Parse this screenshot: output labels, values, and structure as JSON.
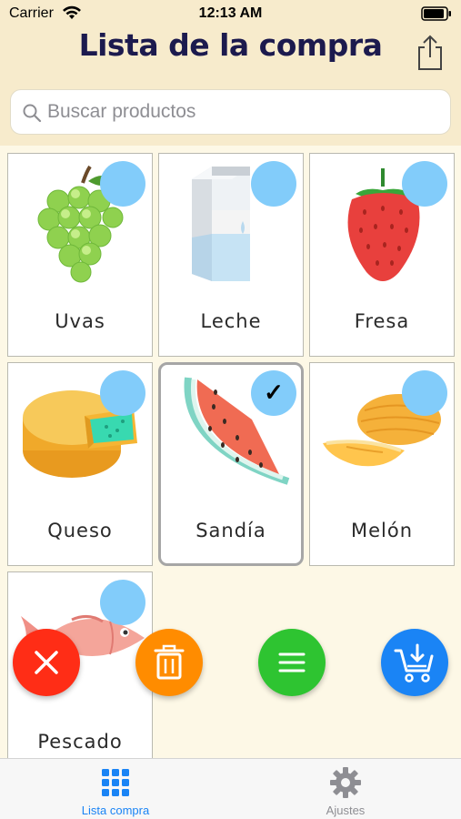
{
  "status_bar": {
    "carrier": "Carrier",
    "time": "12:13 AM"
  },
  "header": {
    "title": "Lista de la compra"
  },
  "search": {
    "placeholder": "Buscar productos"
  },
  "products": [
    {
      "name": "Uvas",
      "selected": false,
      "icon": "grapes-icon"
    },
    {
      "name": "Leche",
      "selected": false,
      "icon": "milk-carton-icon"
    },
    {
      "name": "Fresa",
      "selected": false,
      "icon": "strawberry-icon"
    },
    {
      "name": "Queso",
      "selected": false,
      "icon": "cheese-icon"
    },
    {
      "name": "Sandía",
      "selected": true,
      "icon": "watermelon-icon"
    },
    {
      "name": "Melón",
      "selected": false,
      "icon": "melon-icon"
    },
    {
      "name": "Pescado",
      "selected": false,
      "icon": "fish-icon"
    }
  ],
  "actions": {
    "clear": {
      "icon": "close-icon",
      "color": "#ff2d16"
    },
    "delete": {
      "icon": "trash-icon",
      "color": "#ff8c00"
    },
    "list": {
      "icon": "list-icon",
      "color": "#2ec431"
    },
    "cart": {
      "icon": "cart-download-icon",
      "color": "#1a84f5"
    }
  },
  "colors": {
    "header_bg": "#f7ebcc",
    "page_bg": "#fdf8e6",
    "check_circle": "#82ccfa",
    "tab_active": "#1a84f5",
    "tab_inactive": "#8e8e93"
  },
  "tabs": [
    {
      "label": "Lista compra",
      "icon": "grid-icon",
      "active": true
    },
    {
      "label": "Ajustes",
      "icon": "gear-icon",
      "active": false
    }
  ]
}
